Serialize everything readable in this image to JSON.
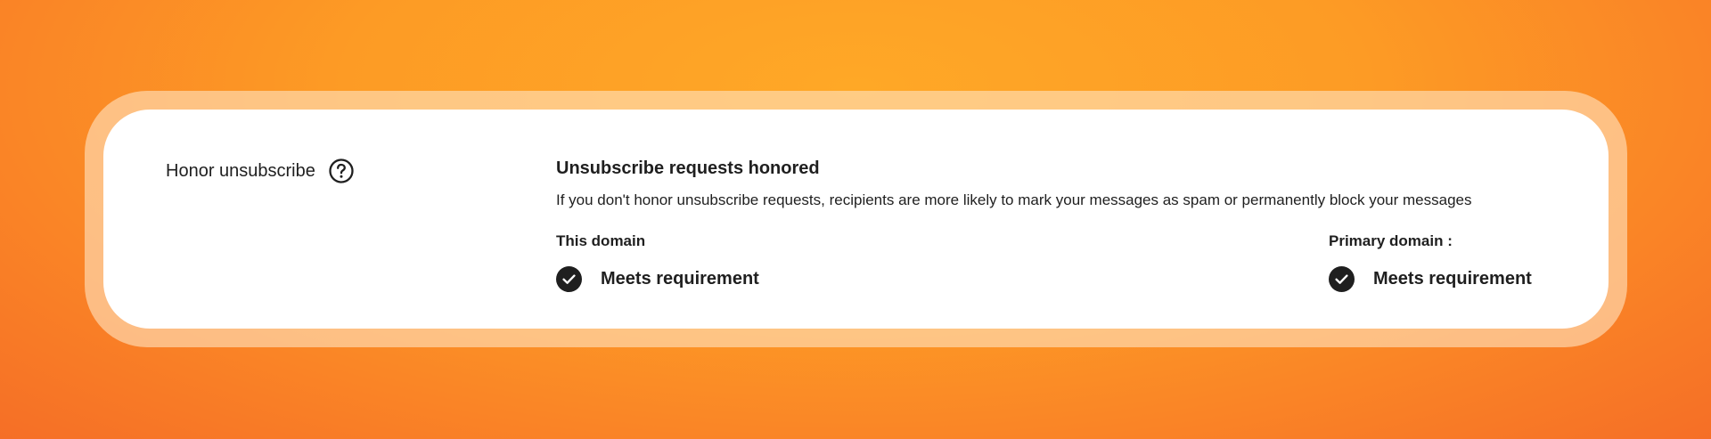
{
  "colors": {
    "background_light": "#ffa826",
    "background_dark": "#f46a26",
    "card": "#ffffff",
    "text": "#1f1f1f"
  },
  "setting": {
    "label": "Honor unsubscribe",
    "help_icon": "question-circle-icon"
  },
  "status": {
    "title": "Unsubscribe requests honored",
    "description": "If you don't honor unsubscribe requests, recipients are more likely to mark your messages as spam or permanently block your messages"
  },
  "this_domain": {
    "label": "This domain",
    "result": "Meets requirement",
    "icon": "check-circle-icon"
  },
  "primary_domain": {
    "label": "Primary domain :",
    "result": "Meets requirement",
    "icon": "check-circle-icon"
  }
}
